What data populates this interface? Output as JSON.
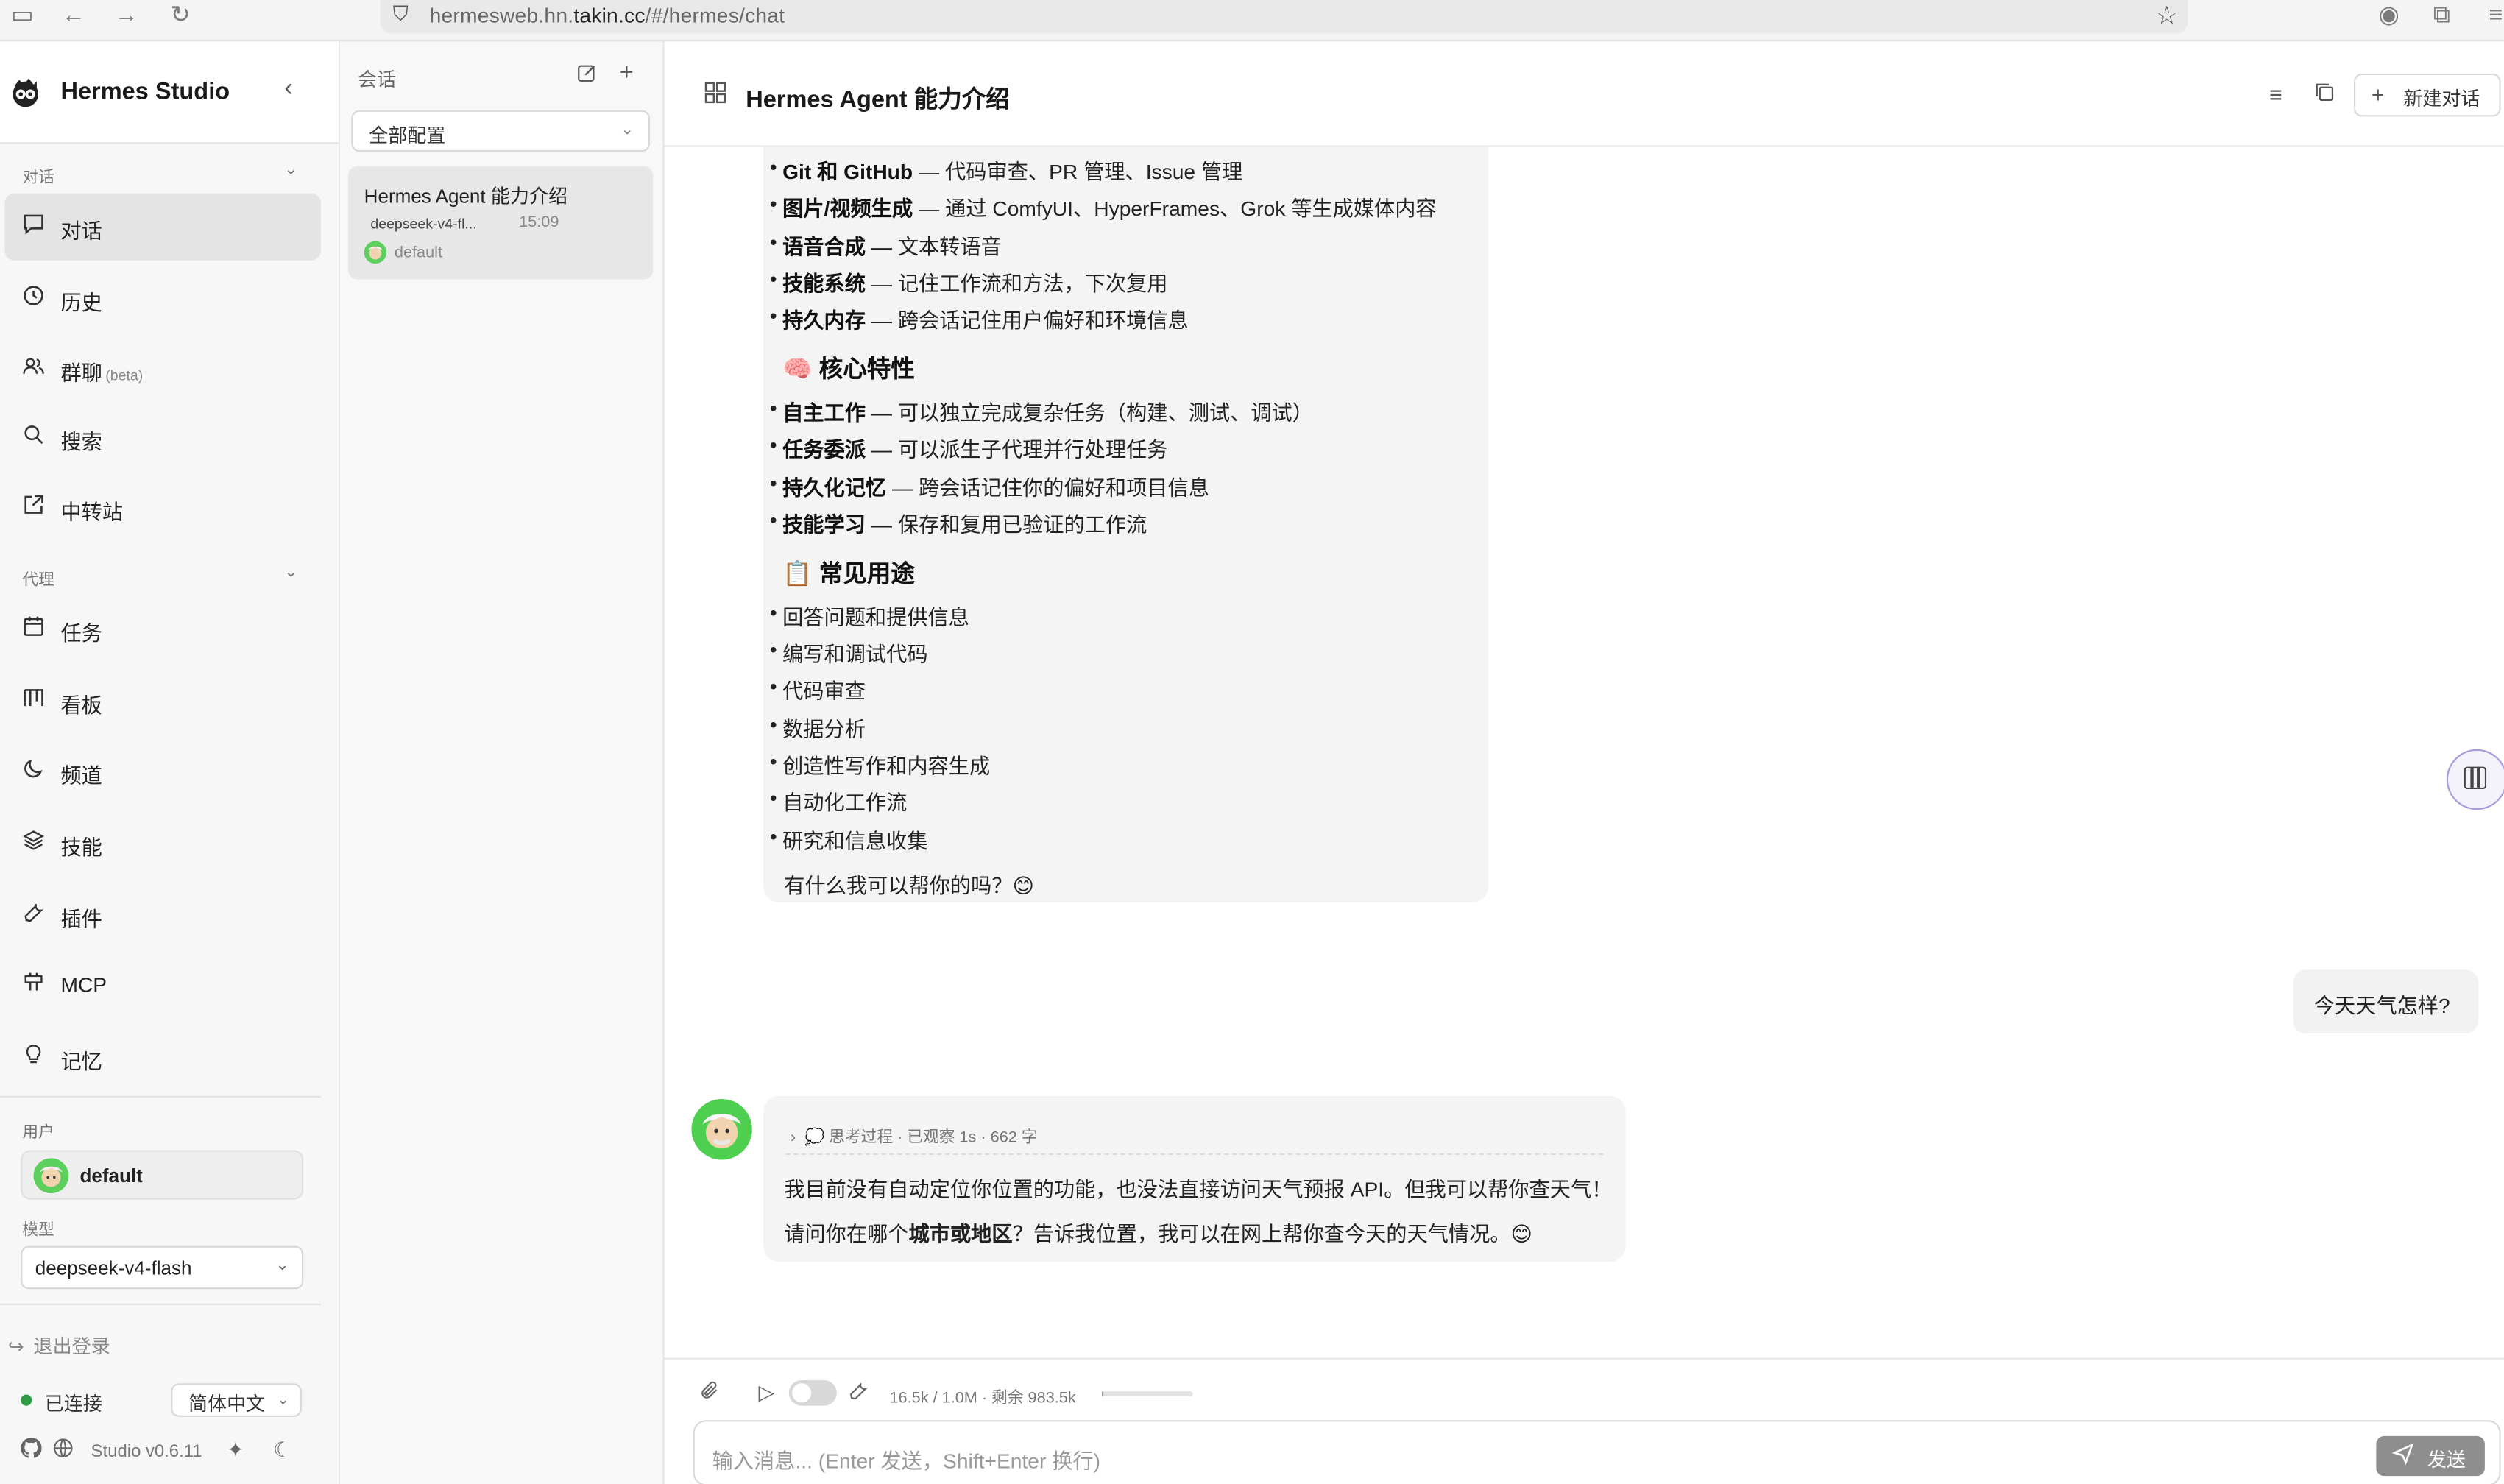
{
  "browser": {
    "url_prefix": "hermesweb.hn.",
    "url_domain": "takin.cc",
    "url_suffix": "/#/hermes/chat"
  },
  "sidebar": {
    "app_name": "Hermes Studio",
    "section_conversation": "对话",
    "nav_top": [
      {
        "icon": "chat-bubble-icon",
        "label": "对话",
        "active": true
      },
      {
        "icon": "clock-icon",
        "label": "历史"
      },
      {
        "icon": "users-icon",
        "label": "群聊",
        "badge": "(beta)"
      },
      {
        "icon": "search-icon",
        "label": "搜索"
      },
      {
        "icon": "external-link-icon",
        "label": "中转站"
      }
    ],
    "section_agent": "代理",
    "nav_agent": [
      {
        "icon": "calendar-icon",
        "label": "任务"
      },
      {
        "icon": "kanban-icon",
        "label": "看板"
      },
      {
        "icon": "moon-icon",
        "label": "频道"
      },
      {
        "icon": "layers-icon",
        "label": "技能"
      },
      {
        "icon": "wrench-icon",
        "label": "插件"
      },
      {
        "icon": "plug-icon",
        "label": "MCP"
      },
      {
        "icon": "lightbulb-icon",
        "label": "记忆"
      }
    ],
    "user_label": "用户",
    "user_name": "default",
    "model_label": "模型",
    "model_value": "deepseek-v4-flash",
    "logout": "退出登录",
    "status": "已连接",
    "language": "简体中文",
    "version": "Studio v0.6.11"
  },
  "sessions": {
    "header": "会话",
    "config_select": "全部配置",
    "items": [
      {
        "title": "Hermes Agent 能力介绍",
        "model": "deepseek-v4-fl...",
        "time": "15:09",
        "profile": "default"
      }
    ]
  },
  "main": {
    "title": "Hermes Agent 能力介绍",
    "new_chat": "新建对话",
    "message1": {
      "tools_list": [
        {
          "bold": "Git 和 GitHub",
          "text": " — 代码审查、PR 管理、Issue 管理"
        },
        {
          "bold": "图片/视频生成",
          "text": " — 通过 ComfyUI、HyperFrames、Grok 等生成媒体内容"
        },
        {
          "bold": "语音合成",
          "text": " — 文本转语音"
        },
        {
          "bold": "技能系统",
          "text": " — 记住工作流和方法，下次复用"
        },
        {
          "bold": "持久内存",
          "text": " — 跨会话记住用户偏好和环境信息"
        }
      ],
      "heading_features": "🧠 核心特性",
      "features": [
        {
          "bold": "自主工作",
          "text": " — 可以独立完成复杂任务（构建、测试、调试）"
        },
        {
          "bold": "任务委派",
          "text": " — 可以派生子代理并行处理任务"
        },
        {
          "bold": "持久化记忆",
          "text": " — 跨会话记住你的偏好和项目信息"
        },
        {
          "bold": "技能学习",
          "text": " — 保存和复用已验证的工作流"
        }
      ],
      "heading_uses": "📋 常见用途",
      "uses": [
        "回答问题和提供信息",
        "编写和调试代码",
        "代码审查",
        "数据分析",
        "创造性写作和内容生成",
        "自动化工作流",
        "研究和信息收集"
      ],
      "closing": "有什么我可以帮你的吗？😊"
    },
    "user_message": "今天天气怎样?",
    "message2": {
      "thinking": "思考过程 · 已观察 1s · 662 字",
      "line1": "我目前没有自动定位你位置的功能，也没法直接访问天气预报 API。但我可以帮你查天气！",
      "line2_pre": "请问你在哪个",
      "line2_bold": "城市或地区",
      "line2_post": "？告诉我位置，我可以在网上帮你查今天的天气情况。😊"
    },
    "composer": {
      "tokens": "16.5k / 1.0M · 剩余 983.5k",
      "token_fraction": 0.0165,
      "placeholder": "输入消息... (Enter 发送，Shift+Enter 换行)",
      "send": "发送"
    }
  }
}
